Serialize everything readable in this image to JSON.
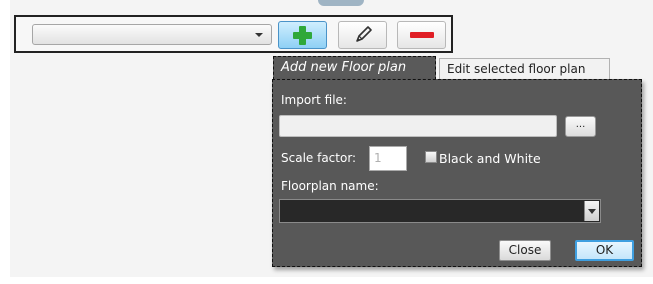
{
  "toolbar": {
    "floorplan_select_value": "",
    "add_icon": "plus-icon",
    "edit_icon": "pencil-icon",
    "delete_icon": "minus-icon"
  },
  "tabs": {
    "add_new": "Add new Floor plan",
    "edit_selected": "Edit selected floor plan"
  },
  "form": {
    "import_label": "Import file:",
    "import_value": "",
    "browse_label": "...",
    "scale_label": "Scale factor:",
    "scale_value": "1",
    "bw_label": "Black and White",
    "name_label": "Floorplan name:",
    "name_value": ""
  },
  "buttons": {
    "close": "Close",
    "ok": "OK"
  },
  "colors": {
    "add_green": "#2fa83a",
    "delete_red": "#e01e25",
    "panel_bg": "#585858",
    "ok_border": "#3f9fe0"
  }
}
